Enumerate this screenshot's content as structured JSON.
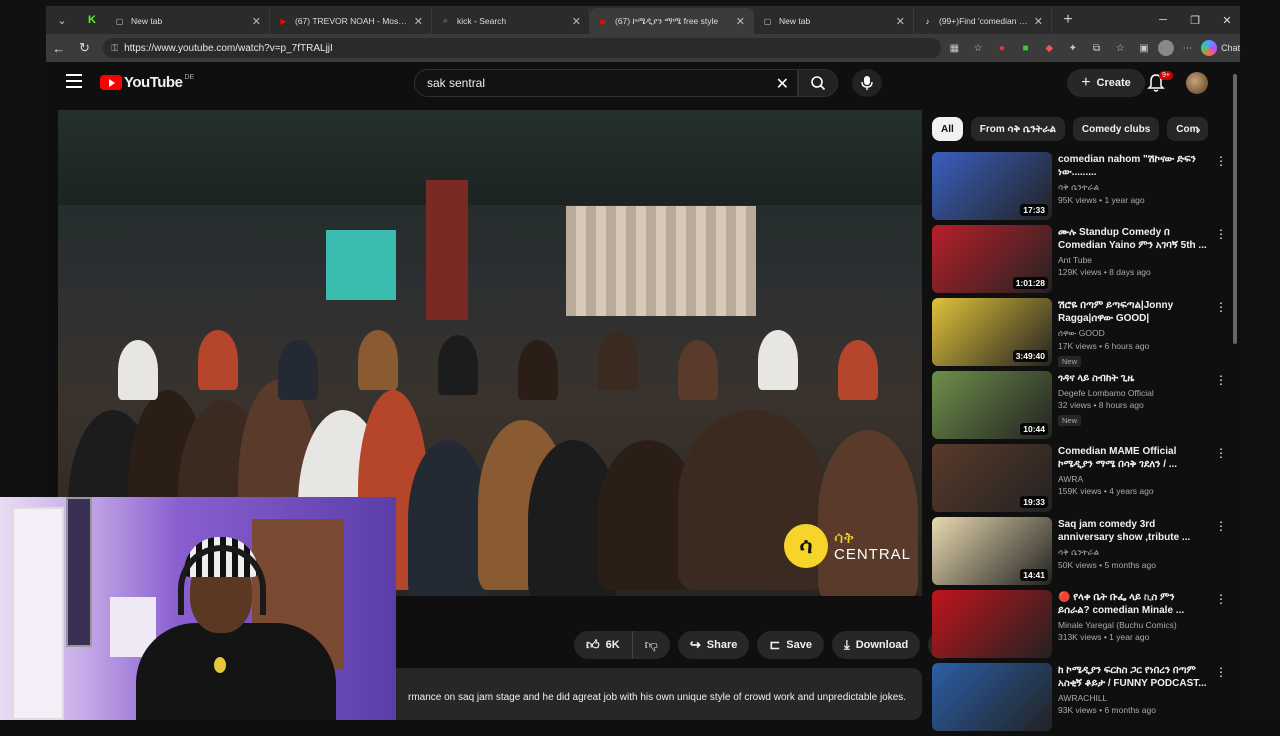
{
  "browser": {
    "tabs": [
      {
        "title": "New tab",
        "icon": "page-icon",
        "fav_color": "#cccccc",
        "fav_char": "▢"
      },
      {
        "title": "(67) TREVOR NOAH - Most View",
        "icon": "youtube-icon",
        "fav_color": "#ff0000",
        "fav_char": "▶"
      },
      {
        "title": "kick - Search",
        "icon": "search-icon",
        "fav_color": "#4a9eff",
        "fav_char": "⌕"
      },
      {
        "title": "(67) ኮሜዲያን ማሜ free style",
        "icon": "youtube-icon",
        "fav_color": "#ff0000",
        "fav_char": "▶",
        "active": true
      },
      {
        "title": "New tab",
        "icon": "page-icon",
        "fav_color": "#cccccc",
        "fav_char": "▢"
      },
      {
        "title": "(99+)Find 'comedian mame' on",
        "icon": "tiktok-icon",
        "fav_color": "#ffffff",
        "fav_char": "♪"
      }
    ],
    "url": "https://www.youtube.com/watch?v=p_7fTRALjjI",
    "chat_label": "Chat"
  },
  "youtube": {
    "country_code": "DE",
    "search_value": "sak sentral",
    "create_label": "Create",
    "notif_count": "9+",
    "actions": {
      "like_count": "6K",
      "share_label": "Share",
      "save_label": "Save",
      "download_label": "Download"
    },
    "description_snippet": "rmance on saq jam stage and he did agreat job with his own unique style of crowd work and unpredictable jokes.",
    "watermark": {
      "glyph": "ሳ",
      "line1": "ሳቅ",
      "line2": "CENTRAL"
    }
  },
  "chips": [
    "All",
    "From ሳቅ ሴንትራል",
    "Comedy clubs",
    "Com"
  ],
  "recommendations": [
    {
      "title": "comedian nahom \"ሽኮናው ድፍን ነው.........",
      "channel": "ሳቅ ሴንትራል",
      "views": "95K views",
      "age": "1 year ago",
      "duration": "17:33",
      "new": "",
      "thumb": "#3a5fbf"
    },
    {
      "title": "ሙሉ Standup Comedy በ Comedian Yaino ምን አገባኝ  5th ...",
      "channel": "Ant Tube",
      "views": "129K views",
      "age": "8 days ago",
      "duration": "1:01:28",
      "new": "",
      "thumb": "#b8202a"
    },
    {
      "title": "ሽሮዬ በጣም ይጣፍጣል|Jonny Ragga|ሰዋው GOOD|",
      "channel": "ሰዋው GOOD",
      "views": "17K views",
      "age": "6 hours ago",
      "duration": "3:49:40",
      "new": "New",
      "thumb": "#e0c23a"
    },
    {
      "title": "ጎዳና ላይ ስብከት ጊዜ",
      "channel": "Degefe Lombamo Official",
      "views": "32 views",
      "age": "8 hours ago",
      "duration": "10:44",
      "new": "New",
      "thumb": "#6e8f4a"
    },
    {
      "title": "Comedian MAME Official ኮሜዲያን ማሜ በሳቅ ገደለን / ...",
      "channel": "AWRA",
      "views": "159K views",
      "age": "4 years ago",
      "duration": "19:33",
      "new": "",
      "thumb": "#5a3a2a"
    },
    {
      "title": "Saq jam comedy 3rd anniversary show ,tribute ...",
      "channel": "ሳቅ ሴንትራል",
      "views": "50K views",
      "age": "5 months ago",
      "duration": "14:41",
      "new": "",
      "thumb": "#e9d9b0"
    },
    {
      "title": "🔴 የላቀ ቤት ቡፌ ላይ ኪስ ምን ይሰራል? comedian Minale ...",
      "channel": "Minale Yaregal (Buchu Comics)",
      "views": "313K views",
      "age": "1 year ago",
      "duration": "",
      "new": "",
      "thumb": "#c0141c"
    },
    {
      "title": "ከ ኮሜዲያን ፍርከስ ጋር የነበረን በጣም አስቂኝ ቆይታ / FUNNY PODCAST...",
      "channel": "AWRACHILL",
      "views": "93K views",
      "age": "6 months ago",
      "duration": "",
      "new": "",
      "thumb": "#2b5fa8"
    }
  ]
}
